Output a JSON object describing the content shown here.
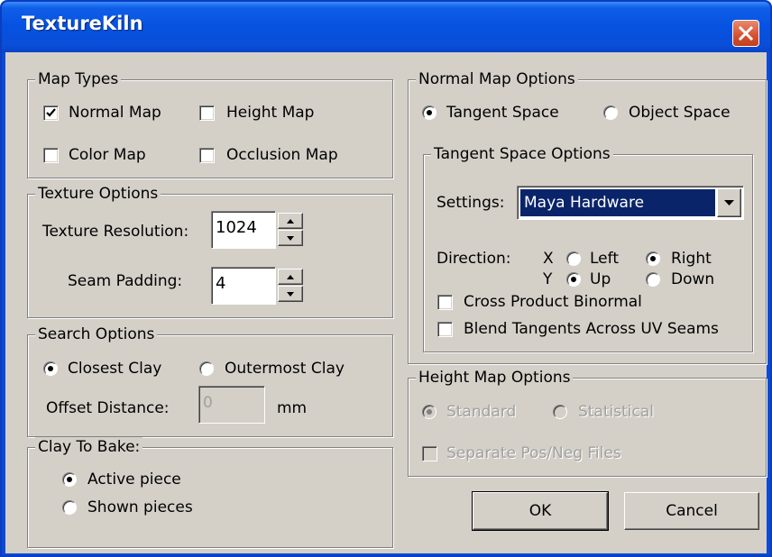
{
  "window": {
    "title": "TextureKiln"
  },
  "map_types": {
    "legend": "Map Types",
    "normal_map": {
      "label": "Normal Map",
      "checked": true
    },
    "height_map": {
      "label": "Height Map",
      "checked": false
    },
    "color_map": {
      "label": "Color Map",
      "checked": false
    },
    "occlusion_map": {
      "label": "Occlusion Map",
      "checked": false
    }
  },
  "texture_options": {
    "legend": "Texture Options",
    "resolution_label": "Texture Resolution:",
    "resolution_value": "1024",
    "padding_label": "Seam Padding:",
    "padding_value": "4"
  },
  "search_options": {
    "legend": "Search Options",
    "closest": "Closest Clay",
    "outermost": "Outermost Clay",
    "selected": "closest",
    "offset_label": "Offset Distance:",
    "offset_value": "0",
    "offset_unit": "mm"
  },
  "clay_to_bake": {
    "legend": "Clay To Bake:",
    "active": "Active piece",
    "shown": "Shown pieces",
    "selected": "active"
  },
  "normal_map_options": {
    "legend": "Normal Map Options",
    "tangent_space": "Tangent Space",
    "object_space": "Object Space",
    "selected": "tangent"
  },
  "tangent_space_options": {
    "legend": "Tangent Space Options",
    "settings_label": "Settings:",
    "settings_value": "Maya Hardware",
    "direction_label": "Direction:",
    "x_label": "X",
    "y_label": "Y",
    "left": "Left",
    "right": "Right",
    "up": "Up",
    "down": "Down",
    "x_selected": "right",
    "y_selected": "up",
    "cross_product": {
      "label": "Cross Product Binormal",
      "checked": false
    },
    "blend_tangents": {
      "label": "Blend Tangents Across UV Seams",
      "checked": false
    }
  },
  "height_map_options": {
    "legend": "Height Map Options",
    "standard": "Standard",
    "statistical": "Statistical",
    "selected": "standard",
    "separate_files": {
      "label": "Separate Pos/Neg Files",
      "checked": false
    }
  },
  "buttons": {
    "ok": "OK",
    "cancel": "Cancel"
  },
  "colors": {
    "titlebar": "#0552e0",
    "face": "#d4d0c8",
    "selection": "#0a246a",
    "close": "#d4512f"
  }
}
